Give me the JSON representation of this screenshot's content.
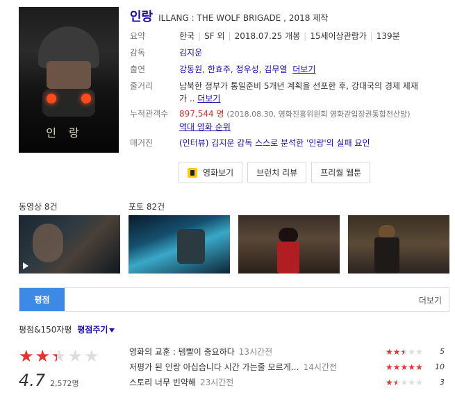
{
  "movie": {
    "title": "인랑",
    "subtitle": "ILLANG : THE WOLF BRIGADE , 2018 제작",
    "poster_text": "인랑"
  },
  "info": {
    "summary_label": "요약",
    "summary_items": [
      "한국",
      "SF 외",
      "2018.07.25 개봉",
      "15세이상관람가",
      "139분"
    ],
    "director_label": "감독",
    "director": "김지운",
    "cast_label": "출연",
    "cast": [
      "강동원",
      "한효주",
      "정우성",
      "김무열"
    ],
    "cast_more": "더보기",
    "plot_label": "줄거리",
    "plot_line1": "남북한 정부가 통일준비 5개년 계획을 선포한 후, 강대국의 경제 제재",
    "plot_line2": "가 ..",
    "plot_more": "더보기",
    "audience_label": "누적관객수",
    "audience_value": "897,544 명",
    "audience_note": "(2018.08.30, 영화진흥위원회 영화관입장권통합전산망)",
    "ranking_link": "역대 영화 순위",
    "magazine_label": "매거진",
    "magazine_link": "(인터뷰) 김지운 감독 스스로 분석한 '인랑'의 실패 요인"
  },
  "buttons": {
    "watch": "영화보기",
    "brunch": "브런치 리뷰",
    "webtoon": "프리퀄 웹툰"
  },
  "media": {
    "video_label": "동영상 8건",
    "photo_label": "포토 82건"
  },
  "tabs": {
    "active": "평점",
    "more": "더보기"
  },
  "ratings": {
    "header": "평점&150자평",
    "write": "평점주기",
    "overall_score": "4.7",
    "overall_fraction": 0.47,
    "count": "2,572명",
    "reviews": [
      {
        "text": "영화의 교훈 : 템빨이 중요하다",
        "time": "13시간전",
        "score": "5",
        "fraction": 0.5
      },
      {
        "text": "저평가 된 인랑 아십습니다 시간 가는줄 모르게…",
        "time": "14시간전",
        "score": "10",
        "fraction": 1.0
      },
      {
        "text": "스토리 너무 빈약해",
        "time": "23시간전",
        "score": "3",
        "fraction": 0.3
      }
    ]
  },
  "colors": {
    "link": "#1a0dab",
    "accent_tab": "#3d8ae6",
    "star": "#e3342f",
    "audience": "#cc3333"
  }
}
